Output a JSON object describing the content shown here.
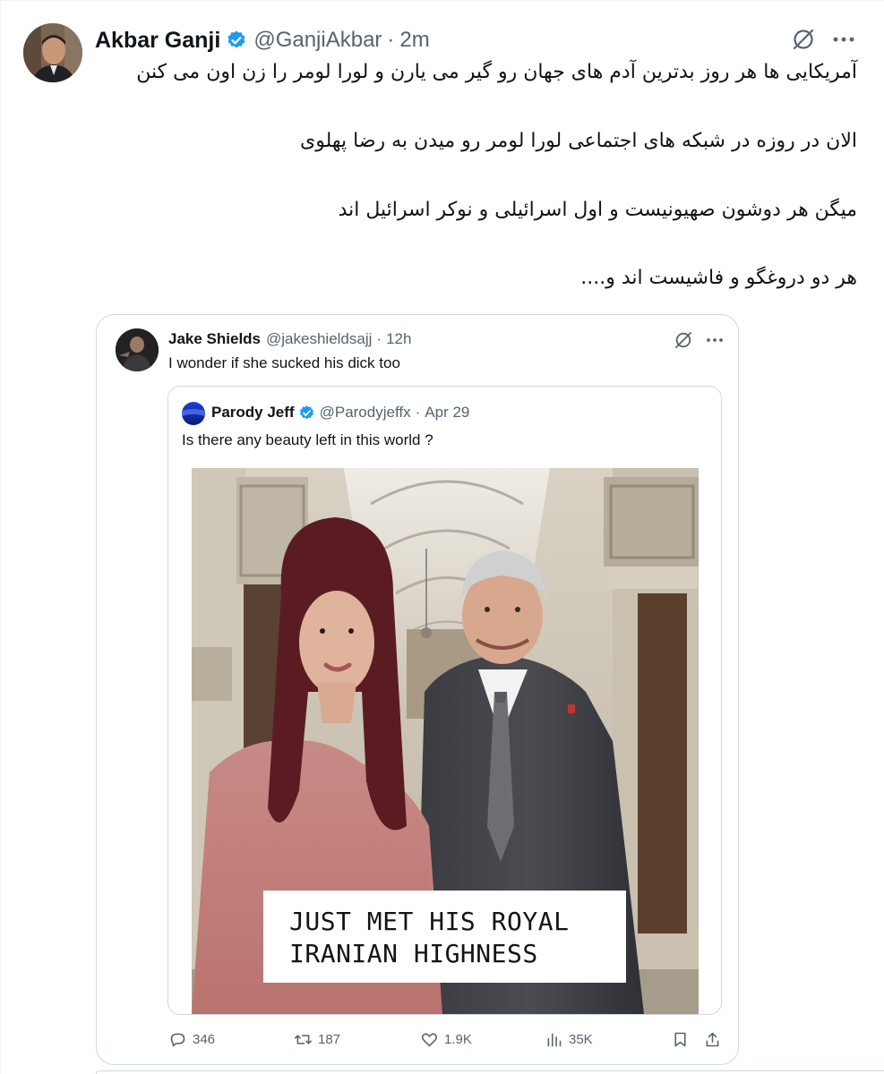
{
  "tweet": {
    "author_name": "Akbar Ganji",
    "handle": "@GanjiAkbar",
    "separator": "·",
    "time": "2m",
    "lines": [
      "آمریکایی ها هر روز بدترین آدم های جهان رو گیر می یارن و لورا لومر را زن اون می کنن",
      "الان در روزه  در شبکه های اجتماعی لورا لومر رو میدن به رضا پهلوی",
      "میگن هر دوشون صهیونیست و اول اسرائیلی و نوکر اسرائیل اند",
      "هر دو دروغگو و فاشیست اند و...."
    ]
  },
  "quote": {
    "author_name": "Jake Shields",
    "handle": "@jakeshieldsajj",
    "separator": "·",
    "time": "12h",
    "text": "I wonder if she sucked his dick too",
    "nested": {
      "author_name": "Parody Jeff",
      "handle": "@Parodyjeffx",
      "separator": "·",
      "time": "Apr 29",
      "text": "Is there any beauty left in this world ?",
      "image_caption_line1": "JUST MET HIS ROYAL",
      "image_caption_line2": "IRANIAN HIGHNESS"
    },
    "actions": {
      "replies": "346",
      "reposts": "187",
      "likes": "1.9K",
      "views": "35K"
    }
  },
  "icons": {
    "verified": "verified-badge-icon",
    "grok": "grok-icon",
    "more": "more-options-icon",
    "reply": "reply-icon",
    "retweet": "retweet-icon",
    "like": "heart-icon",
    "views": "views-chart-icon",
    "bookmark": "bookmark-icon",
    "share": "share-icon"
  },
  "colors": {
    "verified_blue": "#1d9bf0",
    "secondary_text": "#536471",
    "border": "#cfd9de"
  }
}
